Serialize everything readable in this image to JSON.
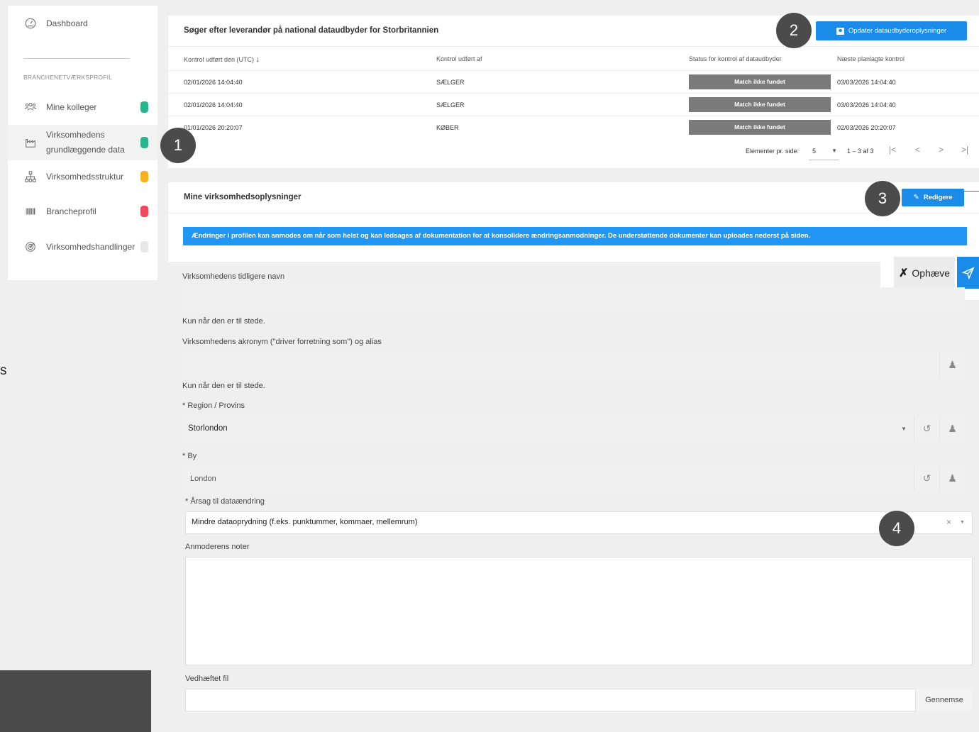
{
  "sidebar": {
    "dashboard": "Dashboard",
    "section_label": "BRANCHENETVÆRKSPROFIL",
    "items": [
      {
        "label": "Mine kolleger",
        "color": "#28b48c"
      },
      {
        "label": "Virksomhedens grundlæggende data",
        "color": "#28b48c"
      },
      {
        "label": "Virksomhedsstruktur",
        "color": "#f7b21b"
      },
      {
        "label": "Brancheprofil",
        "color": "#ef4a5e"
      },
      {
        "label": "Virksomhedshandlinger",
        "color": "#e8e8e8"
      }
    ]
  },
  "edge_text": "s",
  "search_card": {
    "title": "Søger efter leverandør på national dataudbyder for Storbritannien",
    "update_button": "Opdater dataudbyderoplysninger",
    "columns": [
      "Kontrol udført den (UTC)",
      "Kontrol udført af",
      "Status for kontrol af dataudbyder",
      "Næste planlagte kontrol"
    ],
    "rows": [
      {
        "date": "02/01/2026 14:04:40",
        "by": "SÆLGER",
        "status": "Match ikke fundet",
        "next": "03/03/2026 14:04:40"
      },
      {
        "date": "02/01/2026 14:04:40",
        "by": "SÆLGER",
        "status": "Match ikke fundet",
        "next": "03/03/2026 14:04:40"
      },
      {
        "date": "01/01/2026 20:20:07",
        "by": "KØBER",
        "status": "Match ikke fundet",
        "next": "02/03/2026 20:20:07"
      }
    ],
    "pager": {
      "per_page_label": "Elementer pr. side:",
      "per_page": "5",
      "range": "1 – 3 af 3"
    }
  },
  "company_card": {
    "title": "Mine virksomhedsoplysninger",
    "edit_button": "Redigere",
    "banner": "Ændringer i profilen kan anmodes om når som helst og kan ledsages af dokumentation for at konsolidere ændringsanmodninger. De understøttende dokumenter kan uploades nederst på siden."
  },
  "actions": {
    "cancel": "Ophæve"
  },
  "form": {
    "prev_name_label": "Virksomhedens tidligere navn",
    "prev_name_hint": "Kun når den er til stede.",
    "acronym_label": "Virksomhedens akronym (\"driver forretning som\") og alias",
    "acronym_hint": "Kun når den er til stede.",
    "region_label": "* Region / Provins",
    "region_value": "Storlondon",
    "city_label": "* By",
    "city_value": "London",
    "reason_label": "* Årsag til dataændring",
    "reason_value": "Mindre dataoprydning (f.eks. punktummer, kommaer, mellemrum)",
    "notes_label": "Anmoderens noter",
    "attachment_label": "Vedhæftet fil",
    "browse": "Gennemse"
  },
  "callouts": [
    "1",
    "2",
    "3",
    "4"
  ]
}
